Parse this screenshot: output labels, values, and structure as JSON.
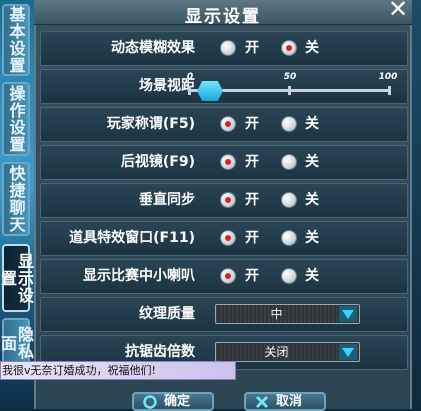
{
  "window": {
    "title": "显示设置",
    "close_glyph": "✕"
  },
  "tabs": [
    {
      "label": "基本设置",
      "active": false
    },
    {
      "label": "操作设置",
      "active": false
    },
    {
      "label": "快捷聊天",
      "active": false
    },
    {
      "label": "显示设置",
      "active": true
    },
    {
      "label": "隐私面",
      "active": false
    }
  ],
  "settings": {
    "motion_blur": {
      "label": "动态模糊效果",
      "on": "开",
      "off": "关",
      "selected": "off"
    },
    "view_distance": {
      "label": "场景视距",
      "min": "0",
      "mid": "50",
      "max": "100",
      "value": 10
    },
    "player_title": {
      "label": "玩家称谓(F5)",
      "on": "开",
      "off": "关",
      "selected": "on"
    },
    "rear_mirror": {
      "label": "后视镜(F9)",
      "on": "开",
      "off": "关",
      "selected": "on"
    },
    "vsync": {
      "label": "垂直同步",
      "on": "开",
      "off": "关",
      "selected": "on"
    },
    "item_effects": {
      "label": "道具特效窗口(F11)",
      "on": "开",
      "off": "关",
      "selected": "on"
    },
    "speaker": {
      "label": "显示比赛中小喇叭",
      "on": "开",
      "off": "关",
      "selected": "on"
    },
    "texture_quality": {
      "label": "纹理质量",
      "value": "中"
    },
    "anti_aliasing": {
      "label": "抗锯齿倍数",
      "value": "关闭"
    }
  },
  "chat_ticker": {
    "text": "我很v无奈订婚成功，祝福他们!"
  },
  "buttons": {
    "confirm": "确定",
    "cancel": "取消"
  },
  "colors": {
    "accent": "#18a7d8",
    "radio_selected": "#e0211b"
  },
  "icons": {
    "close": "close-icon",
    "confirm": "confirm-icon",
    "cancel": "cancel-icon",
    "dropdown": "chevron-down-icon"
  }
}
